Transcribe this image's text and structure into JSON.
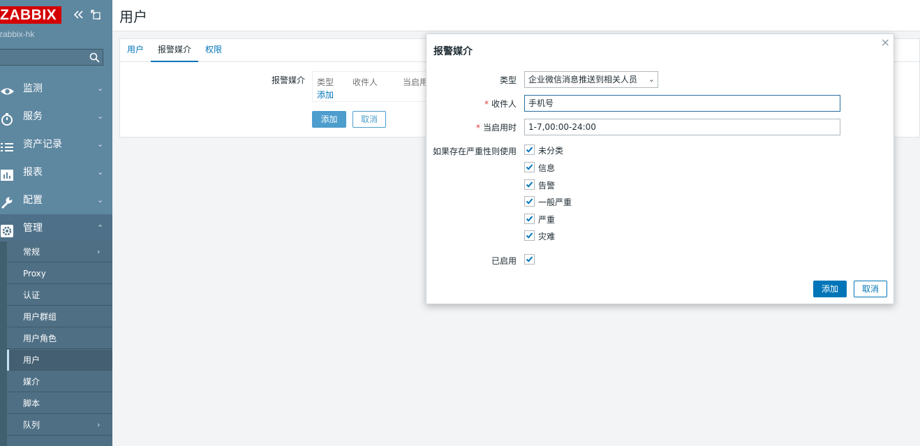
{
  "sidebar": {
    "logo": "ZABBIX",
    "server_name": "zabbix-hk",
    "search_placeholder": "",
    "menu": [
      {
        "label": "监测",
        "icon": "eye-icon"
      },
      {
        "label": "服务",
        "icon": "clock-icon"
      },
      {
        "label": "资产记录",
        "icon": "list-icon"
      },
      {
        "label": "报表",
        "icon": "bar-chart-icon"
      },
      {
        "label": "配置",
        "icon": "wrench-icon"
      },
      {
        "label": "管理",
        "icon": "gear-icon"
      }
    ],
    "submenu": [
      {
        "label": "常规",
        "has_arrow": true
      },
      {
        "label": "Proxy"
      },
      {
        "label": "认证"
      },
      {
        "label": "用户群组"
      },
      {
        "label": "用户角色"
      },
      {
        "label": "用户",
        "active": true
      },
      {
        "label": "媒介"
      },
      {
        "label": "脚本"
      },
      {
        "label": "队列",
        "has_arrow": true
      }
    ]
  },
  "page": {
    "title": "用户",
    "tabs": [
      "用户",
      "报警媒介",
      "权限"
    ],
    "active_tab": "报警媒介",
    "media_label": "报警媒介",
    "media_columns": [
      "类型",
      "收件人",
      "当启用"
    ],
    "add_link": "添加",
    "add_button": "添加",
    "cancel_button": "取消"
  },
  "dialog": {
    "title": "报警媒介",
    "close": "×",
    "type_label": "类型",
    "type_value": "企业微信消息推送到相关人员",
    "sendto_label": "收件人",
    "sendto_value": "手机号",
    "period_label": "当启用时",
    "period_value": "1-7,00:00-24:00",
    "severity_label": "如果存在严重性则使用",
    "severities": [
      "未分类",
      "信息",
      "告警",
      "一般严重",
      "严重",
      "灾难"
    ],
    "enabled_label": "已启用",
    "add_button": "添加",
    "cancel_button": "取消"
  },
  "colors": {
    "sidebar": "#5e87a0",
    "accent": "#0275b8",
    "logo": "#d40000"
  }
}
